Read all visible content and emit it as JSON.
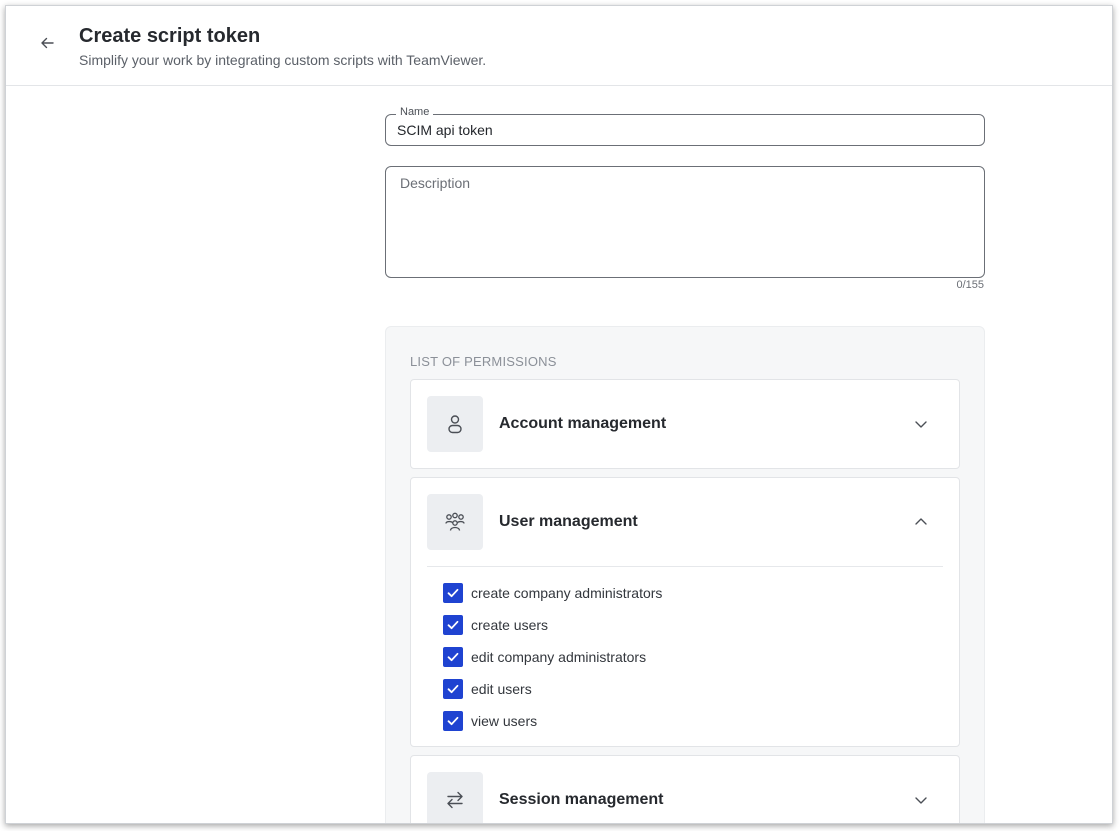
{
  "header": {
    "title": "Create script token",
    "subtitle": "Simplify your work by integrating custom scripts with TeamViewer."
  },
  "form": {
    "name_label": "Name",
    "name_value": "SCIM api token",
    "description_placeholder": "Description",
    "description_value": "",
    "counter": "0/155"
  },
  "permissions": {
    "title": "LIST OF PERMISSIONS",
    "groups": [
      {
        "label": "Account management",
        "icon": "person-icon",
        "expanded": false
      },
      {
        "label": "User management",
        "icon": "users-group-icon",
        "expanded": true,
        "items": [
          {
            "label": "create company administrators",
            "checked": true
          },
          {
            "label": "create users",
            "checked": true
          },
          {
            "label": "edit company administrators",
            "checked": true
          },
          {
            "label": "edit users",
            "checked": true
          },
          {
            "label": "view users",
            "checked": true
          }
        ]
      },
      {
        "label": "Session management",
        "icon": "arrows-swap-icon",
        "expanded": false
      }
    ]
  },
  "colors": {
    "accent": "#1f43d1",
    "panel_bg": "#f6f7f8",
    "icon_tile_bg": "#eceef1"
  }
}
